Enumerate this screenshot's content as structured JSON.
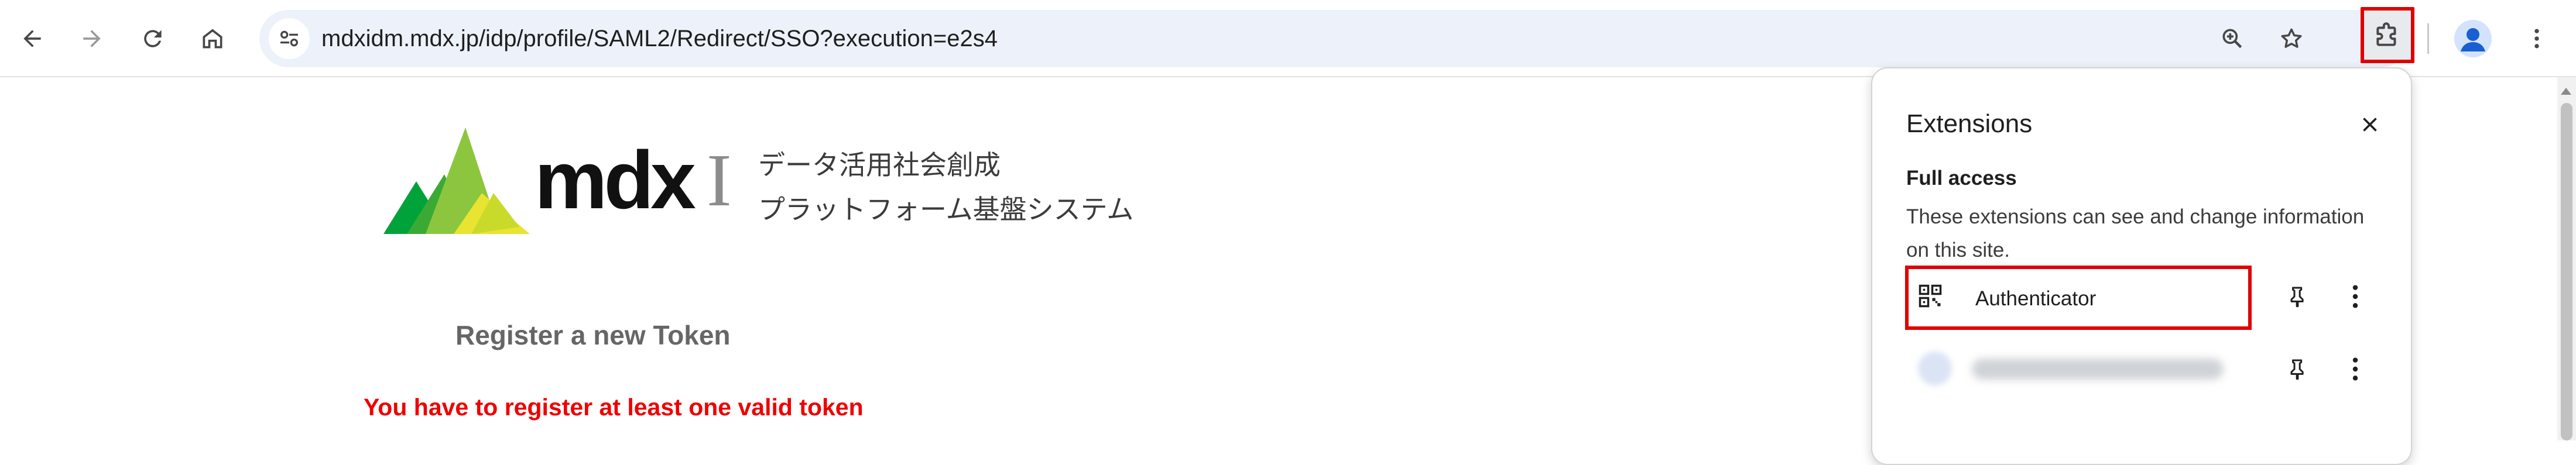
{
  "browser": {
    "url": "mdxidm.mdx.jp/idp/profile/SAML2/Redirect/SSO?execution=e2s4",
    "toolbar_icons": [
      "back-icon",
      "forward-icon",
      "reload-icon",
      "home-icon",
      "site-settings-icon",
      "zoom-icon",
      "star-icon",
      "extensions-puzzle-icon",
      "profile-avatar-icon",
      "kebab-menu-icon"
    ]
  },
  "page": {
    "logo": {
      "wordmark": "mdx",
      "roman_numeral": "I",
      "tagline_line1": "データ活用社会創成",
      "tagline_line2": "プラットフォーム基盤システム",
      "colors": [
        "#00a23a",
        "#5cb531",
        "#9ccd2b",
        "#e8e431"
      ]
    },
    "heading": "Register a new Token",
    "error": "You have to register at least one valid token"
  },
  "extensions_popup": {
    "title": "Extensions",
    "section_title": "Full access",
    "description": "These extensions can see and change information on this site.",
    "items": [
      {
        "name": "Authenticator",
        "icon": "qr-code-icon"
      },
      {
        "name": "",
        "icon": "blurred-extension-icon"
      }
    ]
  },
  "colors": {
    "highlight": "#e00000",
    "error_text": "#ee0000",
    "omnibox_bg": "#edf2fa"
  }
}
